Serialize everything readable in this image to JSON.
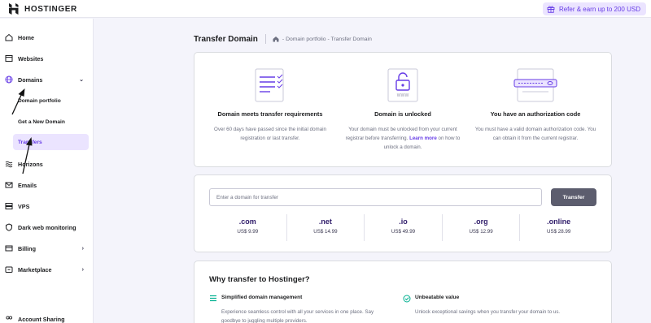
{
  "brand": {
    "name": "HOSTINGER"
  },
  "topbar": {
    "refer_label": "Refer & earn up to 200 USD"
  },
  "sidebar": {
    "items": [
      {
        "label": "Home",
        "icon": "home-icon"
      },
      {
        "label": "Websites",
        "icon": "browser-icon"
      },
      {
        "label": "Domains",
        "icon": "globe-icon"
      },
      {
        "label": "Horizons",
        "icon": "horizons-icon"
      },
      {
        "label": "Emails",
        "icon": "mail-icon"
      },
      {
        "label": "VPS",
        "icon": "server-icon"
      },
      {
        "label": "Dark web monitoring",
        "icon": "shield-icon"
      },
      {
        "label": "Billing",
        "icon": "card-icon"
      },
      {
        "label": "Marketplace",
        "icon": "store-icon"
      },
      {
        "label": "Account Sharing",
        "icon": "users-icon"
      }
    ],
    "domain_subitems": [
      {
        "label": "Domain portfolio"
      },
      {
        "label": "Get a New Domain"
      },
      {
        "label": "Transfers",
        "active": true
      }
    ]
  },
  "page": {
    "title": "Transfer Domain",
    "breadcrumb": "- Domain portfolio - Transfer Domain"
  },
  "requirements": [
    {
      "title": "Domain meets transfer requirements",
      "desc": "Over 60 days have passed since the initial domain registration or last transfer."
    },
    {
      "title": "Domain is unlocked",
      "desc_before": "Your domain must be unlocked from your current registrar before transferring.",
      "link": "Learn more",
      "desc_after": "on how to unlock a domain."
    },
    {
      "title": "You have an authorization code",
      "desc": "You must have a valid domain authorization code. You can obtain it from the current registrar."
    }
  ],
  "transfer_form": {
    "placeholder": "Enter a domain for transfer",
    "button_label": "Transfer"
  },
  "tlds": [
    {
      "ext": ".com",
      "price": "US$ 9.99"
    },
    {
      "ext": ".net",
      "price": "US$ 14.99"
    },
    {
      "ext": ".io",
      "price": "US$ 49.99"
    },
    {
      "ext": ".org",
      "price": "US$ 12.99"
    },
    {
      "ext": ".online",
      "price": "US$ 28.99"
    }
  ],
  "why": {
    "title": "Why transfer to Hostinger?",
    "features": [
      {
        "title": "Simplified domain management",
        "desc": "Experience seamless control with all your services in one place. Say goodbye to juggling multiple providers."
      },
      {
        "title": "Unbeatable value",
        "desc": "Unlock exceptional savings when you transfer your domain to us."
      }
    ]
  },
  "colors": {
    "accent": "#673de6",
    "text": "#1d1e20",
    "muted": "#6d7081",
    "button": "#5c5d6e"
  }
}
